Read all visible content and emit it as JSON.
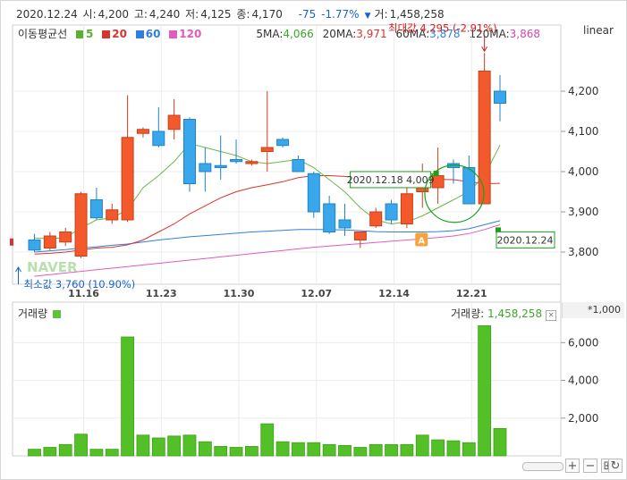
{
  "info": {
    "date": "2020.12.24",
    "open_label": "시:",
    "open": "4,200",
    "high_label": "고:",
    "high": "4,240",
    "low_label": "저:",
    "low": "4,125",
    "close_label": "종:",
    "close": "4,170",
    "change": "-75",
    "change_pct": "-1.77%",
    "volume_label": "거:",
    "volume": "1,458,258"
  },
  "ma_legend": {
    "title": "이동평균선",
    "items": [
      {
        "label": "5",
        "color": "#5ab030"
      },
      {
        "label": "20",
        "color": "#d9342b"
      },
      {
        "label": "60",
        "color": "#2f7fe0"
      },
      {
        "label": "120",
        "color": "#e25bbf"
      }
    ]
  },
  "ma_values": [
    {
      "label": "5MA:",
      "value": "4,066",
      "color": "#3ca62a"
    },
    {
      "label": "20MA:",
      "value": "3,971",
      "color": "#d9342b"
    },
    {
      "label": "60MA:",
      "value": "3,878",
      "color": "#2f7fe0"
    },
    {
      "label": "120MA:",
      "value": "3,868",
      "color": "#d645ad"
    }
  ],
  "scale_label": "linear",
  "volume_panel": {
    "title": "거래량",
    "value_label": "거래량:",
    "value": "1,458,258",
    "unit": "*1,000"
  },
  "annotations": {
    "max_label": "최대값 4,295 (-2.91%)",
    "min_label": "최소값 3,760 (10.90%)",
    "point_1218": "2020.12.18 4,009",
    "point_1224": "2020.12.24",
    "marker_a": "A"
  },
  "watermark": "NAVER",
  "colors": {
    "up": "#f4592c",
    "down": "#3aa7ec",
    "volume": "#52c026"
  },
  "chart_data": {
    "type": "candlestick",
    "x_ticks": [
      "11.16",
      "11.23",
      "11.30",
      "12.07",
      "12.14",
      "12.21"
    ],
    "y_ticks": [
      "3,800",
      "3,900",
      "4,000",
      "4,100",
      "4,200"
    ],
    "ylim": [
      3720,
      4320
    ],
    "volume_ticks": [
      "2,000",
      "4,000",
      "6,000"
    ],
    "volume_ylim": [
      0,
      7200
    ],
    "candles": [
      {
        "o": 3830,
        "h": 3845,
        "l": 3800,
        "c": 3805,
        "v": 350
      },
      {
        "o": 3810,
        "h": 3850,
        "l": 3805,
        "c": 3840,
        "v": 450
      },
      {
        "o": 3825,
        "h": 3860,
        "l": 3815,
        "c": 3850,
        "v": 600
      },
      {
        "o": 3790,
        "h": 3950,
        "l": 3785,
        "c": 3945,
        "v": 1150
      },
      {
        "o": 3930,
        "h": 3960,
        "l": 3880,
        "c": 3885,
        "v": 350
      },
      {
        "o": 3880,
        "h": 3920,
        "l": 3870,
        "c": 3905,
        "v": 350
      },
      {
        "o": 3880,
        "h": 4190,
        "l": 3875,
        "c": 4085,
        "v": 6300
      },
      {
        "o": 4095,
        "h": 4110,
        "l": 4085,
        "c": 4105,
        "v": 1100
      },
      {
        "o": 4100,
        "h": 4160,
        "l": 4060,
        "c": 4065,
        "v": 950
      },
      {
        "o": 4105,
        "h": 4180,
        "l": 4080,
        "c": 4140,
        "v": 1050
      },
      {
        "o": 4130,
        "h": 4135,
        "l": 3950,
        "c": 3970,
        "v": 1100
      },
      {
        "o": 4020,
        "h": 4060,
        "l": 3950,
        "c": 4000,
        "v": 750
      },
      {
        "o": 4015,
        "h": 4090,
        "l": 3980,
        "c": 4010,
        "v": 500
      },
      {
        "o": 4030,
        "h": 4080,
        "l": 4020,
        "c": 4025,
        "v": 450
      },
      {
        "o": 4020,
        "h": 4030,
        "l": 4015,
        "c": 4025,
        "v": 500
      },
      {
        "o": 4050,
        "h": 4200,
        "l": 4000,
        "c": 4060,
        "v": 1700
      },
      {
        "o": 4080,
        "h": 4085,
        "l": 4060,
        "c": 4065,
        "v": 750
      },
      {
        "o": 4030,
        "h": 4040,
        "l": 4000,
        "c": 4000,
        "v": 700
      },
      {
        "o": 3995,
        "h": 4000,
        "l": 3885,
        "c": 3900,
        "v": 700
      },
      {
        "o": 3920,
        "h": 3940,
        "l": 3845,
        "c": 3850,
        "v": 600
      },
      {
        "o": 3880,
        "h": 3920,
        "l": 3840,
        "c": 3860,
        "v": 550
      },
      {
        "o": 3830,
        "h": 3850,
        "l": 3810,
        "c": 3850,
        "v": 450
      },
      {
        "o": 3865,
        "h": 3910,
        "l": 3860,
        "c": 3900,
        "v": 600
      },
      {
        "o": 3920,
        "h": 3930,
        "l": 3870,
        "c": 3880,
        "v": 600
      },
      {
        "o": 3870,
        "h": 3960,
        "l": 3860,
        "c": 3945,
        "v": 600
      },
      {
        "o": 3950,
        "h": 4020,
        "l": 3910,
        "c": 3990,
        "v": 1100
      },
      {
        "o": 3960,
        "h": 4060,
        "l": 3920,
        "c": 3990,
        "v": 850
      },
      {
        "o": 4020,
        "h": 4030,
        "l": 3970,
        "c": 4010,
        "v": 800
      },
      {
        "o": 4010,
        "h": 4040,
        "l": 3920,
        "c": 3920,
        "v": 700
      },
      {
        "o": 3920,
        "h": 4295,
        "l": 3920,
        "c": 4250,
        "v": 6900
      },
      {
        "o": 4200,
        "h": 4240,
        "l": 4125,
        "c": 4170,
        "v": 1450
      }
    ],
    "ma5": [
      3835,
      3833,
      3836,
      3860,
      3880,
      3885,
      3905,
      3960,
      3990,
      4025,
      4070,
      4060,
      4050,
      4040,
      4025,
      4020,
      4025,
      4030,
      4010,
      3980,
      3950,
      3910,
      3880,
      3870,
      3875,
      3890,
      3910,
      3930,
      3950,
      3990,
      4066
    ],
    "ma20": [
      3795,
      3797,
      3800,
      3805,
      3810,
      3812,
      3818,
      3830,
      3850,
      3870,
      3895,
      3915,
      3935,
      3950,
      3960,
      3967,
      3975,
      3985,
      3990,
      3990,
      3988,
      3987,
      3985,
      3984,
      3983,
      3982,
      3981,
      3980,
      3975,
      3970,
      3971
    ],
    "ma60": [
      3800,
      3803,
      3806,
      3810,
      3813,
      3817,
      3820,
      3825,
      3830,
      3834,
      3838,
      3841,
      3844,
      3847,
      3850,
      3852,
      3854,
      3856,
      3856,
      3856,
      3855,
      3853,
      3851,
      3850,
      3850,
      3850,
      3851,
      3853,
      3858,
      3868,
      3878
    ],
    "ma120": [
      3740,
      3744,
      3748,
      3752,
      3756,
      3760,
      3764,
      3768,
      3772,
      3776,
      3780,
      3784,
      3788,
      3792,
      3796,
      3800,
      3804,
      3808,
      3812,
      3815,
      3818,
      3821,
      3824,
      3827,
      3830,
      3833,
      3836,
      3840,
      3846,
      3856,
      3868
    ]
  }
}
